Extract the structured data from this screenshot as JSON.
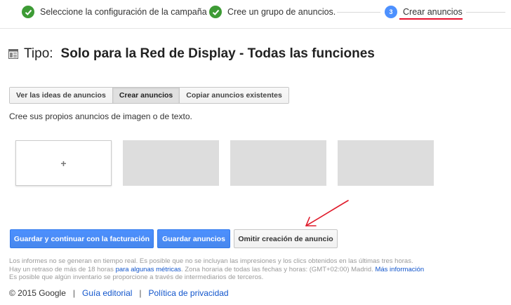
{
  "stepper": {
    "steps": [
      {
        "label": "Seleccione la configuración de la campaña",
        "state": "done"
      },
      {
        "label": "Cree un grupo de anuncios.",
        "state": "done"
      },
      {
        "label": "Crear anuncios",
        "state": "current",
        "number": "3"
      }
    ],
    "colors": {
      "done": "#3d9b35",
      "current": "#4d90fe",
      "underline": "#e8112d"
    }
  },
  "title": {
    "prefix": "Tipo:",
    "main": "Solo para la Red de Display - Todas las funciones"
  },
  "tabs": [
    {
      "label": "Ver las ideas de anuncios",
      "active": false
    },
    {
      "label": "Crear anuncios",
      "active": true
    },
    {
      "label": "Copiar anuncios existentes",
      "active": false
    }
  ],
  "subtitle": "Cree sus propios anuncios de imagen o de texto.",
  "tiles": {
    "add_symbol": "+"
  },
  "buttons": {
    "save_continue": "Guardar y continuar con la facturación",
    "save_ads": "Guardar anuncios",
    "skip": "Omitir creación de anuncio"
  },
  "notice": {
    "line1": "Los informes no se generan en tiempo real. Es posible que no se incluyan las impresiones y los clics obtenidos en las últimas tres horas.",
    "line2_a": "Hay un retraso de más de 18 horas ",
    "line2_link": "para algunas métricas",
    "line2_b": ". Zona horaria de todas las fechas y horas: (GMT+02:00) Madrid. ",
    "line2_link2": "Más información",
    "line3": "Es posible que algún inventario se proporcione a través de intermediarios de terceros."
  },
  "footer": {
    "copyright": "© 2015 Google",
    "separator": "|",
    "editorial": "Guía editorial",
    "privacy": "Política de privacidad"
  }
}
